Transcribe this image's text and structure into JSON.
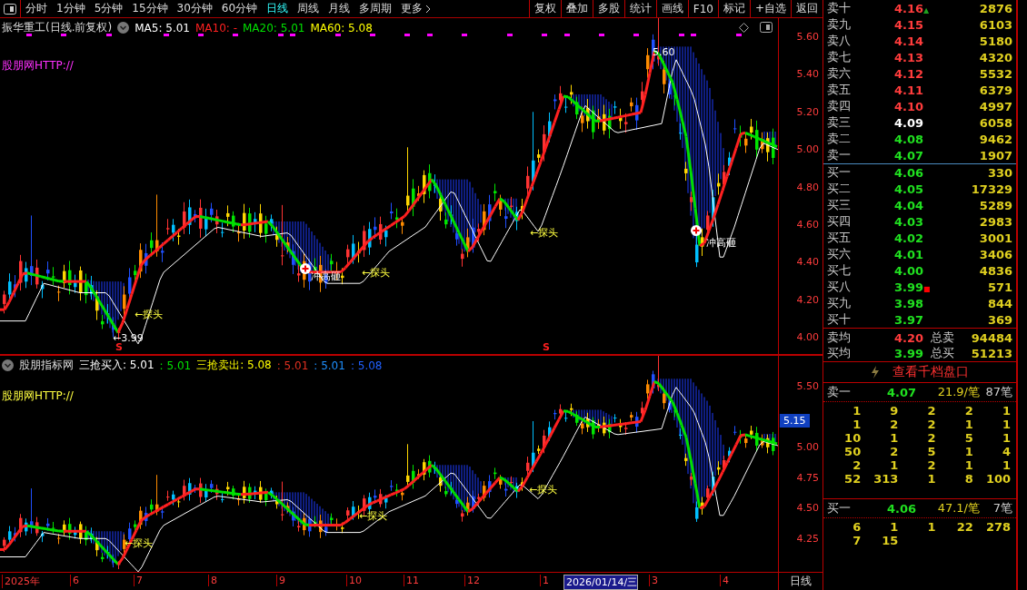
{
  "toolbar": {
    "periods": [
      {
        "label": "分时",
        "selected": false
      },
      {
        "label": "1分钟",
        "selected": false
      },
      {
        "label": "5分钟",
        "selected": false
      },
      {
        "label": "15分钟",
        "selected": false
      },
      {
        "label": "30分钟",
        "selected": false
      },
      {
        "label": "60分钟",
        "selected": false
      },
      {
        "label": "日线",
        "selected": true
      },
      {
        "label": "周线",
        "selected": false
      },
      {
        "label": "月线",
        "selected": false
      },
      {
        "label": "多周期",
        "selected": false
      }
    ],
    "more": "更多",
    "buttons": [
      "复权",
      "叠加",
      "多股",
      "统计",
      "画线",
      "F10",
      "标记",
      "+自选",
      "返回"
    ]
  },
  "main_chart": {
    "title": "振华重工(日线.前复权)",
    "indicators": [
      {
        "label": "MA5: 5.01",
        "color": "#ffffff"
      },
      {
        "label": "MA10: -",
        "color": "#ff2020"
      },
      {
        "label": "MA20: 5.01",
        "color": "#00e000"
      },
      {
        "label": "MA60: 5.08",
        "color": "#ffff00"
      }
    ],
    "caption": "股朋网HTTP://",
    "yticks": [
      "5.60",
      "5.40",
      "5.20",
      "5.00",
      "4.80",
      "4.60",
      "4.40",
      "4.20",
      "4.00"
    ],
    "annotations": [
      {
        "kind": "price",
        "text": "5.60"
      },
      {
        "kind": "price",
        "text": "←3.99"
      },
      {
        "kind": "signal",
        "text": "←探头"
      },
      {
        "kind": "warning",
        "text": "冲高砸"
      },
      {
        "kind": "signal",
        "text": "←探头"
      },
      {
        "kind": "signal",
        "text": "←探头"
      },
      {
        "kind": "warning",
        "text": "冲高砸"
      },
      {
        "kind": "mark",
        "text": "S"
      },
      {
        "kind": "mark",
        "text": "S"
      }
    ]
  },
  "indicator_chart": {
    "title": "股朋指标网",
    "legend": [
      {
        "label": "三抢买入: 5.01",
        "color": "#ffffff"
      },
      {
        "label": ": 5.01",
        "color": "#00e000"
      },
      {
        "label": "三抢卖出: 5.08",
        "color": "#ffff00"
      },
      {
        "label": ": 5.01",
        "color": "#e03020"
      },
      {
        "label": ": 5.01",
        "color": "#1e90ff"
      },
      {
        "label": ": 5.08",
        "color": "#2060ff"
      }
    ],
    "caption": "股朋网HTTP://",
    "yticks": [
      "5.50",
      "5.00",
      "4.75",
      "4.50",
      "4.25"
    ],
    "price_tag": "5.15",
    "annotations": [
      {
        "kind": "signal",
        "text": "←探头"
      },
      {
        "kind": "signal",
        "text": "←探头"
      },
      {
        "kind": "signal",
        "text": "←探头"
      }
    ]
  },
  "time_axis": {
    "labels": [
      {
        "label": "2025年",
        "selected": false
      },
      {
        "label": "6",
        "selected": false
      },
      {
        "label": "7",
        "selected": false
      },
      {
        "label": "8",
        "selected": false
      },
      {
        "label": "9",
        "selected": false
      },
      {
        "label": "10",
        "selected": false
      },
      {
        "label": "11",
        "selected": false
      },
      {
        "label": "12",
        "selected": false
      },
      {
        "label": "1",
        "selected": false
      },
      {
        "label": "2026/01/14/三",
        "selected": true
      },
      {
        "label": "3",
        "selected": false
      },
      {
        "label": "4",
        "selected": false
      }
    ],
    "period": "日线"
  },
  "order_book": {
    "asks": [
      {
        "label": "卖十",
        "price": "4.16",
        "volume": "2876",
        "color": "#ff3c3c",
        "marker": "▲"
      },
      {
        "label": "卖九",
        "price": "4.15",
        "volume": "6103",
        "color": "#ff3c3c"
      },
      {
        "label": "卖八",
        "price": "4.14",
        "volume": "5180",
        "color": "#ff3c3c"
      },
      {
        "label": "卖七",
        "price": "4.13",
        "volume": "4320",
        "color": "#ff3c3c"
      },
      {
        "label": "卖六",
        "price": "4.12",
        "volume": "5532",
        "color": "#ff3c3c"
      },
      {
        "label": "卖五",
        "price": "4.11",
        "volume": "6379",
        "color": "#ff3c3c"
      },
      {
        "label": "卖四",
        "price": "4.10",
        "volume": "4997",
        "color": "#ff3c3c"
      },
      {
        "label": "卖三",
        "price": "4.09",
        "volume": "6058",
        "color": "#ffffff"
      },
      {
        "label": "卖二",
        "price": "4.08",
        "volume": "9462",
        "color": "#20e020"
      },
      {
        "label": "卖一",
        "price": "4.07",
        "volume": "1907",
        "color": "#20e020"
      }
    ],
    "bids": [
      {
        "label": "买一",
        "price": "4.06",
        "volume": "330",
        "color": "#20e020"
      },
      {
        "label": "买二",
        "price": "4.05",
        "volume": "17329",
        "color": "#20e020"
      },
      {
        "label": "买三",
        "price": "4.04",
        "volume": "5289",
        "color": "#20e020"
      },
      {
        "label": "买四",
        "price": "4.03",
        "volume": "2983",
        "color": "#20e020"
      },
      {
        "label": "买五",
        "price": "4.02",
        "volume": "3001",
        "color": "#20e020"
      },
      {
        "label": "买六",
        "price": "4.01",
        "volume": "3406",
        "color": "#20e020"
      },
      {
        "label": "买七",
        "price": "4.00",
        "volume": "4836",
        "color": "#20e020"
      },
      {
        "label": "买八",
        "price": "3.99",
        "volume": "571",
        "color": "#20e020",
        "marker": "■"
      },
      {
        "label": "买九",
        "price": "3.98",
        "volume": "844",
        "color": "#20e020"
      },
      {
        "label": "买十",
        "price": "3.97",
        "volume": "369",
        "color": "#20e020"
      }
    ],
    "summary": [
      {
        "label": "卖均",
        "price": "4.20",
        "color": "#ff3c3c",
        "total_label": "总卖",
        "total": "94484"
      },
      {
        "label": "买均",
        "price": "3.99",
        "color": "#20e020",
        "total_label": "总买",
        "total": "51213"
      }
    ],
    "depth_link": "查看千档盘口",
    "queues": [
      {
        "label": "卖一",
        "price": "4.07",
        "average": "21.9/笔",
        "count": "87笔",
        "orders": [
          "1",
          "9",
          "2",
          "2",
          "1",
          "1",
          "2",
          "2",
          "1",
          "1",
          "10",
          "1",
          "2",
          "5",
          "1",
          "50",
          "2",
          "5",
          "1",
          "4",
          "2",
          "1",
          "2",
          "1",
          "1",
          "52",
          "313",
          "1",
          "8",
          "100"
        ]
      },
      {
        "label": "买一",
        "price": "4.06",
        "average": "47.1/笔",
        "count": "7笔",
        "orders": [
          "6",
          "1",
          "1",
          "22",
          "278",
          "7",
          "15"
        ]
      }
    ]
  }
}
